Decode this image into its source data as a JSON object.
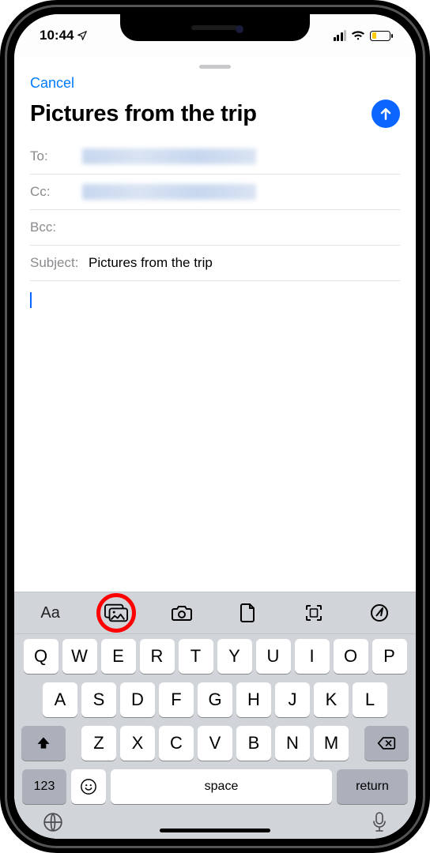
{
  "status": {
    "time": "10:44",
    "location_indicator": "location-arrow-icon"
  },
  "sheet": {
    "cancel": "Cancel",
    "title": "Pictures from the trip",
    "send_icon": "arrow-up-icon"
  },
  "fields": {
    "to_label": "To:",
    "cc_label": "Cc:",
    "bcc_label": "Bcc:",
    "subject_label": "Subject:",
    "subject_value": "Pictures from the trip"
  },
  "toolbar": {
    "items": [
      {
        "name": "text-format-icon",
        "label": "Aa"
      },
      {
        "name": "photo-library-icon"
      },
      {
        "name": "camera-icon"
      },
      {
        "name": "document-icon"
      },
      {
        "name": "scan-document-icon"
      },
      {
        "name": "markup-icon"
      }
    ]
  },
  "keyboard": {
    "row1": [
      "Q",
      "W",
      "E",
      "R",
      "T",
      "Y",
      "U",
      "I",
      "O",
      "P"
    ],
    "row2": [
      "A",
      "S",
      "D",
      "F",
      "G",
      "H",
      "J",
      "K",
      "L"
    ],
    "row3": [
      "Z",
      "X",
      "C",
      "V",
      "B",
      "N",
      "M"
    ],
    "numbers_key": "123",
    "space_key": "space",
    "return_key": "return"
  },
  "annotation": {
    "circled_item": "photo-library-icon"
  }
}
